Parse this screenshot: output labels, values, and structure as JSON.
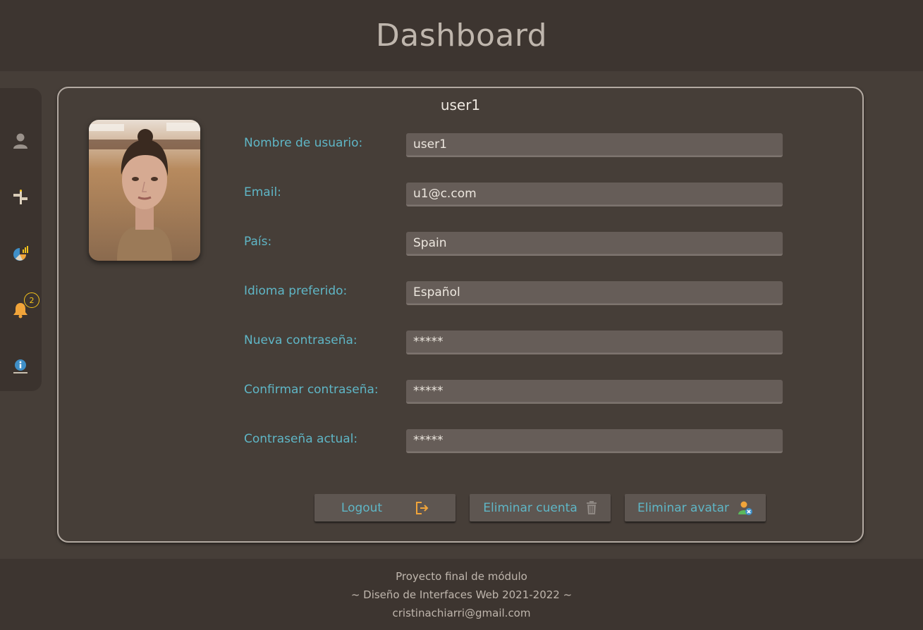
{
  "header": {
    "title": "Dashboard"
  },
  "sidebar": {
    "items": [
      {
        "icon": "user-icon"
      },
      {
        "icon": "signpost-icon"
      },
      {
        "icon": "chart-icon"
      },
      {
        "icon": "bell-icon",
        "badge": "2"
      },
      {
        "icon": "info-icon"
      }
    ]
  },
  "profile": {
    "username_title": "user1",
    "avatar": "avatar-photo",
    "fields": [
      {
        "label": "Nombre de usuario:",
        "value": "user1"
      },
      {
        "label": "Email:",
        "value": "u1@c.com"
      },
      {
        "label": "País:",
        "value": "Spain"
      },
      {
        "label": "Idioma preferido:",
        "value": "Español"
      },
      {
        "label": "Nueva contraseña:",
        "value": "*****"
      },
      {
        "label": "Confirmar contraseña:",
        "value": "*****"
      },
      {
        "label": "Contraseña actual:",
        "value": "*****"
      }
    ],
    "buttons": {
      "logout": "Logout",
      "delete_account": "Eliminar cuenta",
      "delete_avatar": "Eliminar avatar"
    }
  },
  "footer": {
    "line1": "Proyecto final de módulo",
    "line2": "~ Diseño de Interfaces Web 2021-2022 ~",
    "line3": "cristinachiarri@gmail.com"
  },
  "colors": {
    "accent": "#5fb6c6",
    "badge": "#f3c21b",
    "background": "#463e38",
    "header": "#3d3530"
  }
}
